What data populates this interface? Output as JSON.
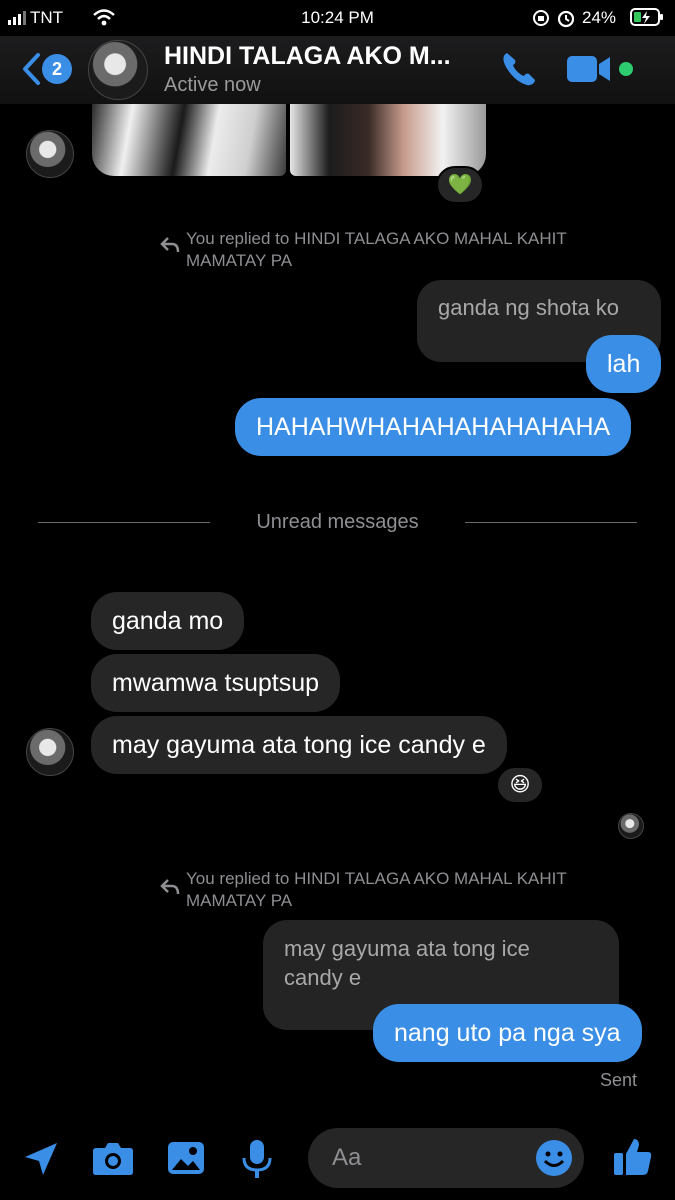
{
  "status_bar": {
    "carrier": "TNT",
    "time": "10:24 PM",
    "battery_percent": "24%"
  },
  "header": {
    "back_badge_count": "2",
    "contact_name": "HINDI TALAGA AKO M...",
    "presence": "Active now",
    "online_color": "#2ecc71"
  },
  "thread": {
    "top_reaction": "💚",
    "reply_notice_1": "You replied to HINDI TALAGA AKO MAHAL KAHIT MAMATAY PA",
    "quoted_1": "ganda ng shota ko",
    "outgoing_1": "lah",
    "outgoing_2": "HAHAHWHAHAHAHAHAHAHA",
    "unread_divider": "Unread messages",
    "incoming_1": "ganda mo",
    "incoming_2": "mwamwa tsuptsup",
    "incoming_3": "may gayuma ata tong ice candy e",
    "incoming_3_reaction": "😆",
    "reply_notice_2": "You replied to HINDI TALAGA AKO MAHAL KAHIT MAMATAY PA",
    "quoted_2": "may gayuma ata tong ice candy e",
    "outgoing_3": "nang uto pa nga sya",
    "delivery_status": "Sent"
  },
  "composer": {
    "placeholder": "Aa",
    "icons": [
      "location-icon",
      "camera-icon",
      "gallery-icon",
      "microphone-icon",
      "emoji-icon",
      "thumbs-up-icon"
    ],
    "accent_color": "#3a8ee6"
  }
}
